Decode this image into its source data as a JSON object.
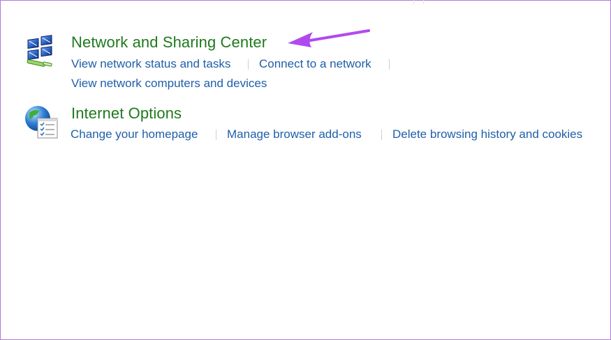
{
  "sections": [
    {
      "title": "Network and Sharing Center",
      "icon": "network-icon",
      "links": [
        "View network status and tasks",
        "Connect to a network",
        "View network computers and devices"
      ]
    },
    {
      "title": "Internet Options",
      "icon": "internet-options-icon",
      "links": [
        "Change your homepage",
        "Manage browser add-ons",
        "Delete browsing history and cookies"
      ]
    }
  ],
  "colors": {
    "title_green": "#1e7a1e",
    "link_blue": "#1f5fa8",
    "annotation_purple": "#b04af0",
    "frame_border": "#b07ad6"
  }
}
